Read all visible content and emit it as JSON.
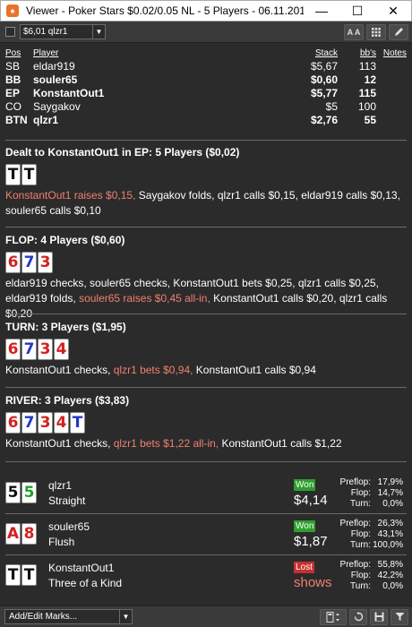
{
  "window": {
    "title": "Viewer - Poker Stars $0.02/0.05 NL - 5 Players - 06.11.2019 12:21",
    "minimize_icon": "minimize-icon",
    "maximize_icon": "maximize-icon",
    "close_icon": "close-icon"
  },
  "toolbar": {
    "selected_value": "$6,01 qlzr1",
    "aa_label": "A A",
    "grid_icon": "grid-icon",
    "pencil_icon": "pencil-icon"
  },
  "players": {
    "headers": {
      "pos": "Pos",
      "player": "Player",
      "stack": "Stack",
      "bb": "bb's",
      "notes": "Notes"
    },
    "rows": [
      {
        "pos": "SB",
        "name": "eldar919",
        "stack": "$5,67",
        "bb": "113",
        "bold": false
      },
      {
        "pos": "BB",
        "name": "souler65",
        "stack": "$0,60",
        "bb": "12",
        "bold": true
      },
      {
        "pos": "EP",
        "name": "KonstantOut1",
        "stack": "$5,77",
        "bb": "115",
        "bold": true
      },
      {
        "pos": "CO",
        "name": "Saygakov",
        "stack": "$5",
        "bb": "100",
        "bold": false
      },
      {
        "pos": "BTN",
        "name": "qlzr1",
        "stack": "$2,76",
        "bb": "55",
        "bold": true
      }
    ]
  },
  "preflop": {
    "title": "Dealt to KonstantOut1 in EP: 5 Players ($0,02)",
    "cards": [
      "T",
      "T"
    ],
    "action_hl": "KonstantOut1 raises $0,15,",
    "action_rest": " Saygakov folds, qlzr1 calls $0,15, eldar919 calls $0,13, souler65 calls $0,10"
  },
  "flop": {
    "title": "FLOP: 4 Players ($0,60)",
    "cards": [
      "6",
      "7",
      "3"
    ],
    "action_a": "eldar919 checks, souler65 checks, KonstantOut1 bets $0,25, qlzr1 calls $0,25, eldar919 folds, ",
    "action_hl": "souler65 raises $0,45 all-in,",
    "action_b": " KonstantOut1 calls $0,20, qlzr1 calls $0,20"
  },
  "turn": {
    "title": "TURN: 3 Players ($1,95)",
    "cards": [
      "6",
      "7",
      "3",
      "4"
    ],
    "action_a": "KonstantOut1 checks, ",
    "action_hl": "qlzr1 bets $0,94,",
    "action_b": " KonstantOut1 calls $0,94"
  },
  "river": {
    "title": "RIVER: 3 Players ($3,83)",
    "cards": [
      "6",
      "7",
      "3",
      "4",
      "T"
    ],
    "action_a": "KonstantOut1 checks, ",
    "action_hl": "qlzr1 bets $1,22 all-in,",
    "action_b": " KonstantOut1 calls $1,22"
  },
  "results": [
    {
      "cards": [
        "5",
        "5"
      ],
      "name": "qlzr1",
      "hand": "Straight",
      "status": "Won",
      "amount": "$4,14",
      "stats": [
        {
          "label": "Preflop:",
          "value": "17,9%"
        },
        {
          "label": "Flop:",
          "value": "14,7%"
        },
        {
          "label": "Turn:",
          "value": "0,0%"
        }
      ]
    },
    {
      "cards": [
        "A",
        "8"
      ],
      "name": "souler65",
      "hand": "Flush",
      "status": "Won",
      "amount": "$1,87",
      "stats": [
        {
          "label": "Preflop:",
          "value": "26,3%"
        },
        {
          "label": "Flop:",
          "value": "43,1%"
        },
        {
          "label": "Turn:",
          "value": "100,0%"
        }
      ]
    },
    {
      "cards": [
        "T",
        "T"
      ],
      "name": "KonstantOut1",
      "hand": "Three of a Kind",
      "status": "Lost",
      "amount": "shows",
      "stats": [
        {
          "label": "Preflop:",
          "value": "55,8%"
        },
        {
          "label": "Flop:",
          "value": "42,2%"
        },
        {
          "label": "Turn:",
          "value": "0,0%"
        }
      ]
    }
  ],
  "bottombar": {
    "marks_label": "Add/Edit Marks...",
    "calc_icon": "calculator-icon",
    "replay_icon": "replay-icon",
    "save_icon": "save-icon",
    "filter_icon": "filter-icon"
  }
}
